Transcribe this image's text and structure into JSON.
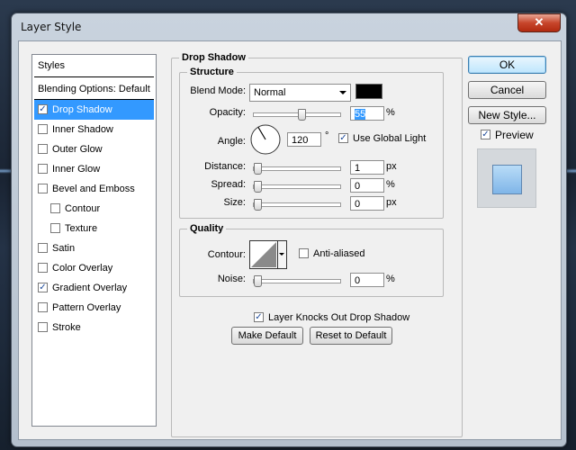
{
  "window": {
    "title": "Layer Style",
    "close_glyph": "✕"
  },
  "styles_list": {
    "header": "Styles",
    "blending": "Blending Options: Default",
    "items": [
      {
        "label": "Drop Shadow",
        "checked": true,
        "selected": true,
        "sub": false
      },
      {
        "label": "Inner Shadow",
        "checked": false,
        "selected": false,
        "sub": false
      },
      {
        "label": "Outer Glow",
        "checked": false,
        "selected": false,
        "sub": false
      },
      {
        "label": "Inner Glow",
        "checked": false,
        "selected": false,
        "sub": false
      },
      {
        "label": "Bevel and Emboss",
        "checked": false,
        "selected": false,
        "sub": false
      },
      {
        "label": "Contour",
        "checked": false,
        "selected": false,
        "sub": true
      },
      {
        "label": "Texture",
        "checked": false,
        "selected": false,
        "sub": true
      },
      {
        "label": "Satin",
        "checked": false,
        "selected": false,
        "sub": false
      },
      {
        "label": "Color Overlay",
        "checked": false,
        "selected": false,
        "sub": false
      },
      {
        "label": "Gradient Overlay",
        "checked": true,
        "selected": false,
        "sub": false
      },
      {
        "label": "Pattern Overlay",
        "checked": false,
        "selected": false,
        "sub": false
      },
      {
        "label": "Stroke",
        "checked": false,
        "selected": false,
        "sub": false
      }
    ]
  },
  "drop_shadow": {
    "title": "Drop Shadow",
    "structure": {
      "title": "Structure",
      "blend_mode_label": "Blend Mode:",
      "blend_mode_value": "Normal",
      "shadow_color": "#000000",
      "opacity_label": "Opacity:",
      "opacity_value": "55",
      "opacity_fraction": 0.55,
      "percent": "%",
      "angle_label": "Angle:",
      "angle_value": "120",
      "degree": "°",
      "use_global_light": "Use Global Light",
      "distance_label": "Distance:",
      "distance_value": "1",
      "spread_label": "Spread:",
      "spread_value": "0",
      "size_label": "Size:",
      "size_value": "0",
      "px": "px"
    },
    "quality": {
      "title": "Quality",
      "contour_label": "Contour:",
      "anti_aliased": "Anti-aliased",
      "noise_label": "Noise:",
      "noise_value": "0",
      "percent": "%"
    },
    "knocks_out": "Layer Knocks Out Drop Shadow",
    "make_default": "Make Default",
    "reset_default": "Reset to Default"
  },
  "buttons": {
    "ok": "OK",
    "cancel": "Cancel",
    "new_style": "New Style..."
  },
  "preview": {
    "label": "Preview",
    "checked": true
  }
}
